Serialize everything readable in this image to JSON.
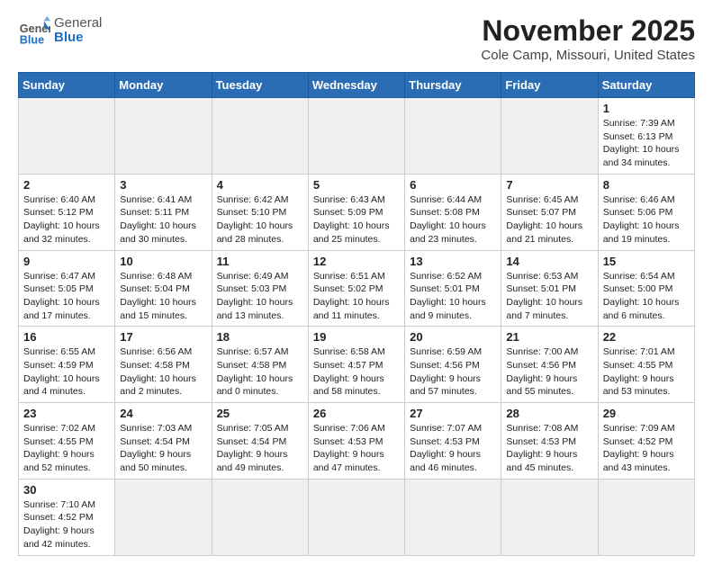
{
  "header": {
    "logo_general": "General",
    "logo_blue": "Blue",
    "month": "November 2025",
    "location": "Cole Camp, Missouri, United States"
  },
  "weekdays": [
    "Sunday",
    "Monday",
    "Tuesday",
    "Wednesday",
    "Thursday",
    "Friday",
    "Saturday"
  ],
  "weeks": [
    [
      {
        "day": "",
        "info": ""
      },
      {
        "day": "",
        "info": ""
      },
      {
        "day": "",
        "info": ""
      },
      {
        "day": "",
        "info": ""
      },
      {
        "day": "",
        "info": ""
      },
      {
        "day": "",
        "info": ""
      },
      {
        "day": "1",
        "info": "Sunrise: 7:39 AM\nSunset: 6:13 PM\nDaylight: 10 hours\nand 34 minutes."
      }
    ],
    [
      {
        "day": "2",
        "info": "Sunrise: 6:40 AM\nSunset: 5:12 PM\nDaylight: 10 hours\nand 32 minutes."
      },
      {
        "day": "3",
        "info": "Sunrise: 6:41 AM\nSunset: 5:11 PM\nDaylight: 10 hours\nand 30 minutes."
      },
      {
        "day": "4",
        "info": "Sunrise: 6:42 AM\nSunset: 5:10 PM\nDaylight: 10 hours\nand 28 minutes."
      },
      {
        "day": "5",
        "info": "Sunrise: 6:43 AM\nSunset: 5:09 PM\nDaylight: 10 hours\nand 25 minutes."
      },
      {
        "day": "6",
        "info": "Sunrise: 6:44 AM\nSunset: 5:08 PM\nDaylight: 10 hours\nand 23 minutes."
      },
      {
        "day": "7",
        "info": "Sunrise: 6:45 AM\nSunset: 5:07 PM\nDaylight: 10 hours\nand 21 minutes."
      },
      {
        "day": "8",
        "info": "Sunrise: 6:46 AM\nSunset: 5:06 PM\nDaylight: 10 hours\nand 19 minutes."
      }
    ],
    [
      {
        "day": "9",
        "info": "Sunrise: 6:47 AM\nSunset: 5:05 PM\nDaylight: 10 hours\nand 17 minutes."
      },
      {
        "day": "10",
        "info": "Sunrise: 6:48 AM\nSunset: 5:04 PM\nDaylight: 10 hours\nand 15 minutes."
      },
      {
        "day": "11",
        "info": "Sunrise: 6:49 AM\nSunset: 5:03 PM\nDaylight: 10 hours\nand 13 minutes."
      },
      {
        "day": "12",
        "info": "Sunrise: 6:51 AM\nSunset: 5:02 PM\nDaylight: 10 hours\nand 11 minutes."
      },
      {
        "day": "13",
        "info": "Sunrise: 6:52 AM\nSunset: 5:01 PM\nDaylight: 10 hours\nand 9 minutes."
      },
      {
        "day": "14",
        "info": "Sunrise: 6:53 AM\nSunset: 5:01 PM\nDaylight: 10 hours\nand 7 minutes."
      },
      {
        "day": "15",
        "info": "Sunrise: 6:54 AM\nSunset: 5:00 PM\nDaylight: 10 hours\nand 6 minutes."
      }
    ],
    [
      {
        "day": "16",
        "info": "Sunrise: 6:55 AM\nSunset: 4:59 PM\nDaylight: 10 hours\nand 4 minutes."
      },
      {
        "day": "17",
        "info": "Sunrise: 6:56 AM\nSunset: 4:58 PM\nDaylight: 10 hours\nand 2 minutes."
      },
      {
        "day": "18",
        "info": "Sunrise: 6:57 AM\nSunset: 4:58 PM\nDaylight: 10 hours\nand 0 minutes."
      },
      {
        "day": "19",
        "info": "Sunrise: 6:58 AM\nSunset: 4:57 PM\nDaylight: 9 hours\nand 58 minutes."
      },
      {
        "day": "20",
        "info": "Sunrise: 6:59 AM\nSunset: 4:56 PM\nDaylight: 9 hours\nand 57 minutes."
      },
      {
        "day": "21",
        "info": "Sunrise: 7:00 AM\nSunset: 4:56 PM\nDaylight: 9 hours\nand 55 minutes."
      },
      {
        "day": "22",
        "info": "Sunrise: 7:01 AM\nSunset: 4:55 PM\nDaylight: 9 hours\nand 53 minutes."
      }
    ],
    [
      {
        "day": "23",
        "info": "Sunrise: 7:02 AM\nSunset: 4:55 PM\nDaylight: 9 hours\nand 52 minutes."
      },
      {
        "day": "24",
        "info": "Sunrise: 7:03 AM\nSunset: 4:54 PM\nDaylight: 9 hours\nand 50 minutes."
      },
      {
        "day": "25",
        "info": "Sunrise: 7:05 AM\nSunset: 4:54 PM\nDaylight: 9 hours\nand 49 minutes."
      },
      {
        "day": "26",
        "info": "Sunrise: 7:06 AM\nSunset: 4:53 PM\nDaylight: 9 hours\nand 47 minutes."
      },
      {
        "day": "27",
        "info": "Sunrise: 7:07 AM\nSunset: 4:53 PM\nDaylight: 9 hours\nand 46 minutes."
      },
      {
        "day": "28",
        "info": "Sunrise: 7:08 AM\nSunset: 4:53 PM\nDaylight: 9 hours\nand 45 minutes."
      },
      {
        "day": "29",
        "info": "Sunrise: 7:09 AM\nSunset: 4:52 PM\nDaylight: 9 hours\nand 43 minutes."
      }
    ],
    [
      {
        "day": "30",
        "info": "Sunrise: 7:10 AM\nSunset: 4:52 PM\nDaylight: 9 hours\nand 42 minutes."
      },
      {
        "day": "",
        "info": ""
      },
      {
        "day": "",
        "info": ""
      },
      {
        "day": "",
        "info": ""
      },
      {
        "day": "",
        "info": ""
      },
      {
        "day": "",
        "info": ""
      },
      {
        "day": "",
        "info": ""
      }
    ]
  ]
}
